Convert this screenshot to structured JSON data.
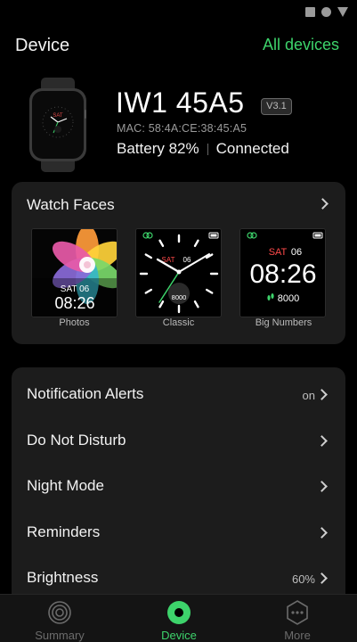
{
  "header": {
    "title": "Device",
    "all_devices_link": "All devices"
  },
  "device": {
    "name": "IW1 45A5",
    "firmware": "V3.1",
    "mac": "MAC: 58:4A:CE:38:45:A5",
    "battery": "Battery 82%",
    "status": "Connected"
  },
  "watch_faces": {
    "title": "Watch Faces",
    "faces": [
      {
        "label": "Photos",
        "date": "SAT 06",
        "time": "08:26"
      },
      {
        "label": "Classic",
        "date": "SAT",
        "day": "06",
        "steps": "8000"
      },
      {
        "label": "Big Numbers",
        "date": "SAT",
        "day": "06",
        "time": "08:26",
        "steps": "8000"
      }
    ]
  },
  "settings": {
    "items": [
      {
        "label": "Notification Alerts",
        "value": "on"
      },
      {
        "label": "Do Not Disturb",
        "value": ""
      },
      {
        "label": "Night Mode",
        "value": ""
      },
      {
        "label": "Reminders",
        "value": ""
      },
      {
        "label": "Brightness",
        "value": "60%"
      }
    ]
  },
  "tabs": [
    {
      "label": "Summary",
      "icon": "summary-icon",
      "active": false
    },
    {
      "label": "Device",
      "icon": "device-icon",
      "active": true
    },
    {
      "label": "More",
      "icon": "more-icon",
      "active": false
    }
  ],
  "colors": {
    "accent": "#3dd36b",
    "background": "#000000",
    "card": "#1c1c1c",
    "date_red": "#ff4a4a"
  }
}
